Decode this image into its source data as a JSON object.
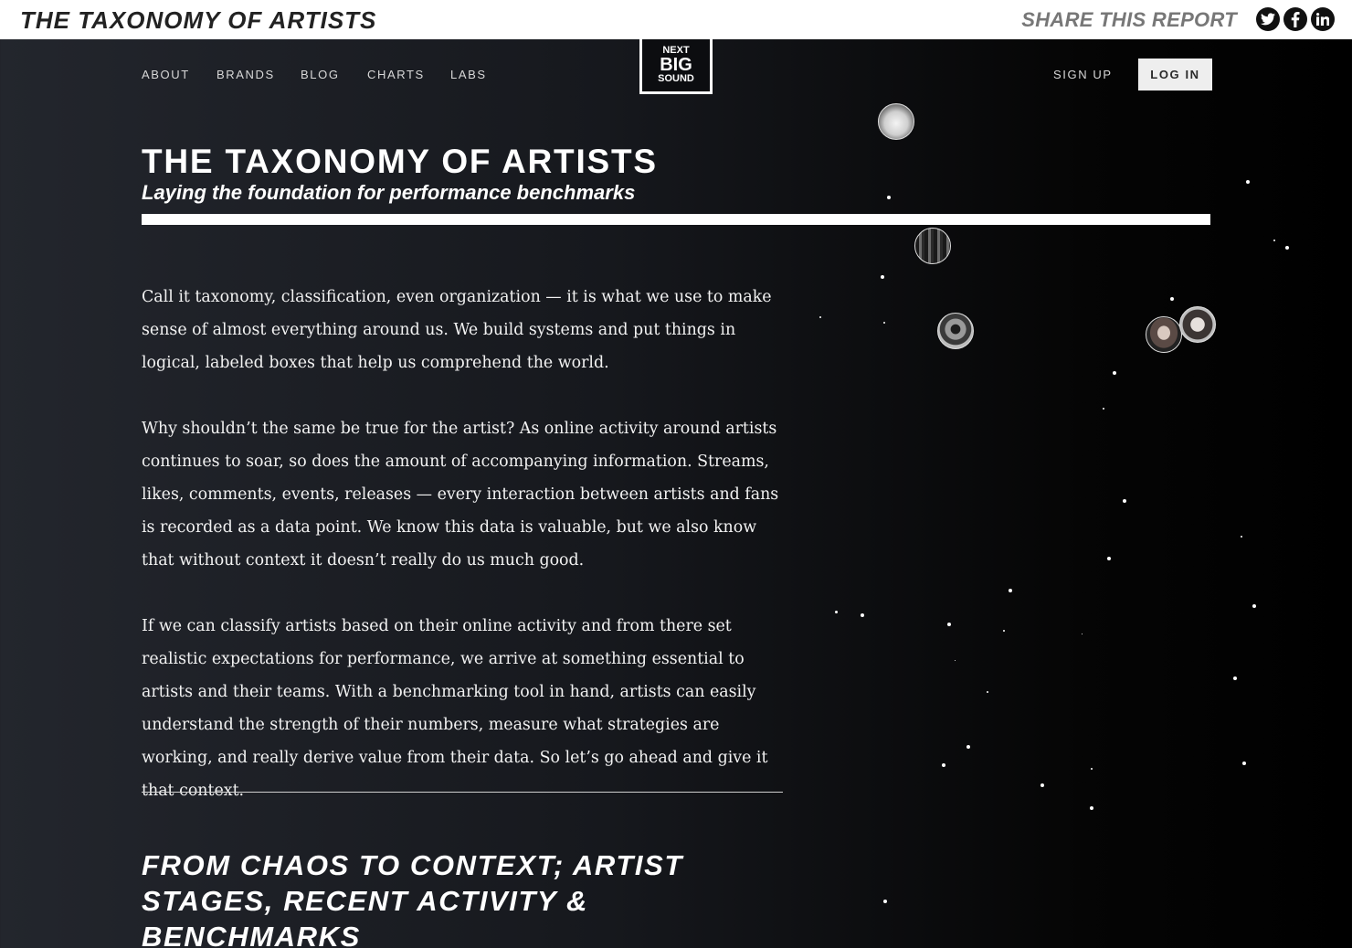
{
  "share_bar": {
    "title": "THE TAXONOMY OF ARTISTS",
    "share_label": "SHARE THIS REPORT",
    "icons": [
      "twitter-icon",
      "facebook-icon",
      "linkedin-icon"
    ]
  },
  "nav": {
    "links": [
      "ABOUT",
      "BRANDS",
      "BLOG",
      "CHARTS",
      "LABS"
    ],
    "logo": {
      "line1": "NEXT",
      "line2": "BIG",
      "line3": "SOUND"
    },
    "sign_up": "SIGN UP",
    "log_in": "LOG IN"
  },
  "hero": {
    "title": "THE TAXONOMY OF ARTISTS",
    "subtitle": "Laying the foundation for performance benchmarks"
  },
  "article": {
    "paragraphs": [
      "Call it taxonomy, classification, even organization — it is what we use to make sense of almost everything around us. We build systems and put things in logical, labeled boxes that help us comprehend the world.",
      "Why shouldn’t the same be true for the artist? As online activity around artists continues to soar, so does the amount of accompanying information. Streams, likes, comments, events, releases — every interaction between artists and fans is recorded as a data point. We know this data is valuable, but we also know that without context it doesn’t really do us much good.",
      "If we can classify artists based on their online activity and from there set realistic expectations for performance, we arrive at something essential to artists and their teams. With a benchmarking tool in hand, artists can easily understand the strength of their numbers, measure what strategies are working, and really derive value from their data. So let’s go ahead and give it that context."
    ],
    "section_heading": "FROM CHAOS TO CONTEXT; ARTIST STAGES, RECENT ACTIVITY & BENCHMARKS"
  },
  "colors": {
    "background_left": "#23262d",
    "background_right": "#000000",
    "share_bar": "#ffffff",
    "login_button": "#eeeeee"
  }
}
